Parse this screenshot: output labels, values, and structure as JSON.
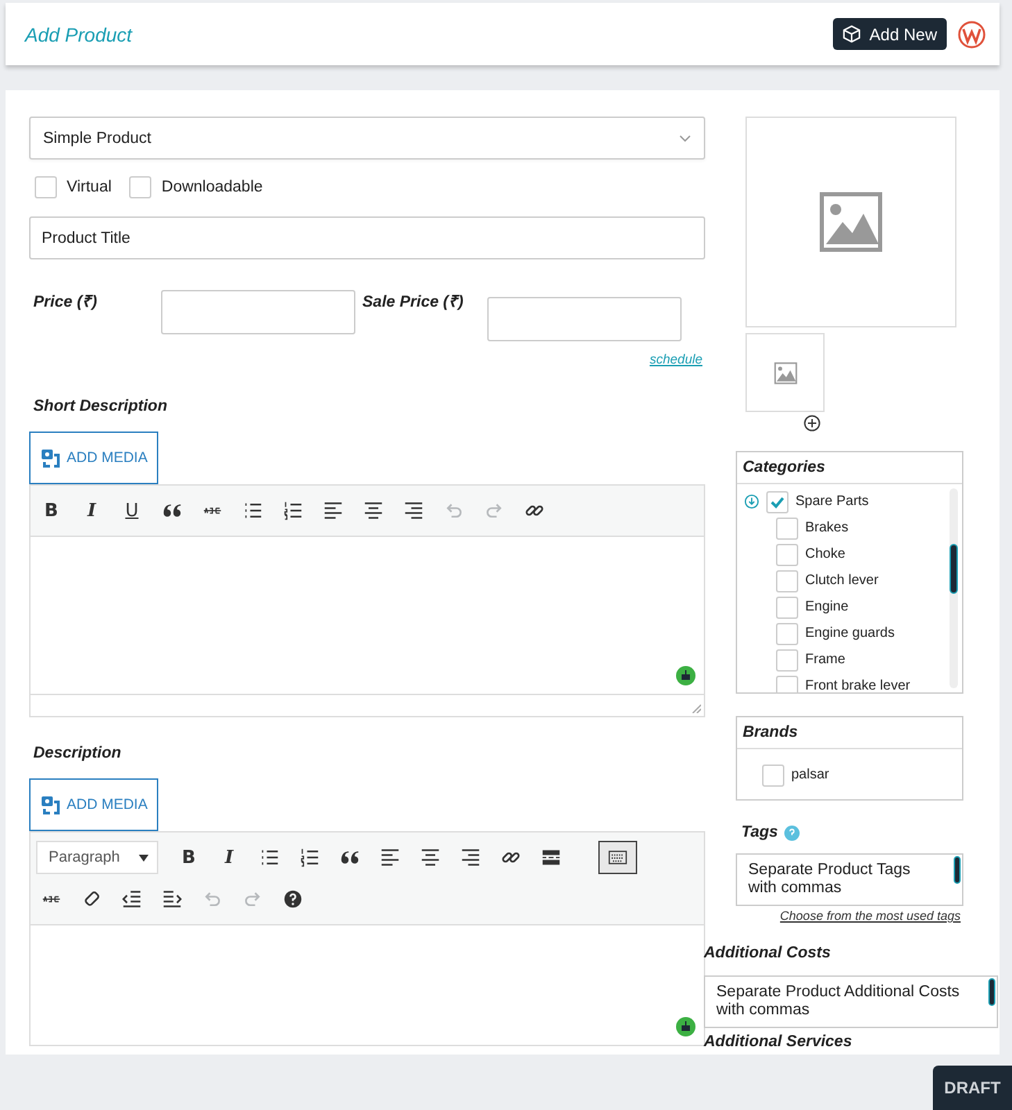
{
  "header": {
    "title": "Add Product",
    "add_new": "Add New"
  },
  "product_type": {
    "value": "Simple Product"
  },
  "options": [
    {
      "label": "Virtual",
      "checked": false
    },
    {
      "label": "Downloadable",
      "checked": false
    }
  ],
  "title_field": {
    "placeholder": "Product Title"
  },
  "price": {
    "label": "Price (₹)"
  },
  "sale_price": {
    "label": "Sale Price (₹)",
    "link": "schedule"
  },
  "editors": [
    {
      "label": "Short Description",
      "add_media": "ADD MEDIA",
      "resizable": true,
      "toolbar_rows": [
        [
          {
            "kind": "bold",
            "label": "B",
            "disabled": false
          },
          {
            "kind": "italic",
            "label": "I",
            "disabled": false
          },
          {
            "kind": "underline",
            "label": "U",
            "disabled": false
          },
          {
            "kind": "quote",
            "disabled": false
          },
          {
            "kind": "strike",
            "disabled": false
          },
          {
            "kind": "ul",
            "disabled": false
          },
          {
            "kind": "ol",
            "disabled": false
          },
          {
            "kind": "align-left",
            "disabled": false
          },
          {
            "kind": "align-center",
            "disabled": false
          },
          {
            "kind": "align-right",
            "disabled": false
          },
          {
            "kind": "undo",
            "disabled": true
          },
          {
            "kind": "redo",
            "disabled": true
          },
          {
            "kind": "link",
            "disabled": false
          }
        ]
      ]
    },
    {
      "label": "Description",
      "add_media": "ADD MEDIA",
      "resizable": false,
      "toolbar_rows": [
        [
          {
            "kind": "format",
            "label": "Paragraph",
            "disabled": false
          },
          {
            "kind": "bold",
            "label": "B",
            "disabled": false
          },
          {
            "kind": "italic",
            "label": "I",
            "disabled": false
          },
          {
            "kind": "ul",
            "disabled": false
          },
          {
            "kind": "ol",
            "disabled": false
          },
          {
            "kind": "quote",
            "disabled": false
          },
          {
            "kind": "align-left",
            "disabled": false
          },
          {
            "kind": "align-center",
            "disabled": false
          },
          {
            "kind": "align-right",
            "disabled": false
          },
          {
            "kind": "link",
            "disabled": false
          },
          {
            "kind": "more",
            "disabled": false
          },
          {
            "kind": "toggle",
            "on": true,
            "disabled": false
          }
        ],
        [
          {
            "kind": "strike",
            "disabled": false
          },
          {
            "kind": "eraser",
            "disabled": false
          },
          {
            "kind": "outdent",
            "disabled": false
          },
          {
            "kind": "indent",
            "disabled": false
          },
          {
            "kind": "undo",
            "disabled": true
          },
          {
            "kind": "redo",
            "disabled": true
          },
          {
            "kind": "help",
            "disabled": false
          }
        ]
      ]
    }
  ],
  "categories": {
    "title": "Categories",
    "items": [
      {
        "label": "Spare Parts",
        "checked": true,
        "children": [
          {
            "label": "Brakes",
            "checked": false
          },
          {
            "label": "Choke",
            "checked": false
          },
          {
            "label": "Clutch lever",
            "checked": false
          },
          {
            "label": "Engine",
            "checked": false
          },
          {
            "label": "Engine guards",
            "checked": false
          },
          {
            "label": "Frame",
            "checked": false
          },
          {
            "label": "Front brake lever",
            "checked": false
          }
        ]
      }
    ]
  },
  "brands": {
    "title": "Brands",
    "items": [
      {
        "label": "palsar",
        "checked": false
      }
    ]
  },
  "tags": {
    "label": "Tags",
    "field": {
      "placeholder": "Separate Product Tags with commas"
    },
    "link": "Choose from the most used tags"
  },
  "additional_costs": {
    "label": "Additional Costs",
    "field": {
      "placeholder": "Separate Product Additional Costs with commas"
    }
  },
  "additional_services": {
    "label": "Additional Services"
  },
  "footer": {
    "draft": "DRAFT"
  }
}
